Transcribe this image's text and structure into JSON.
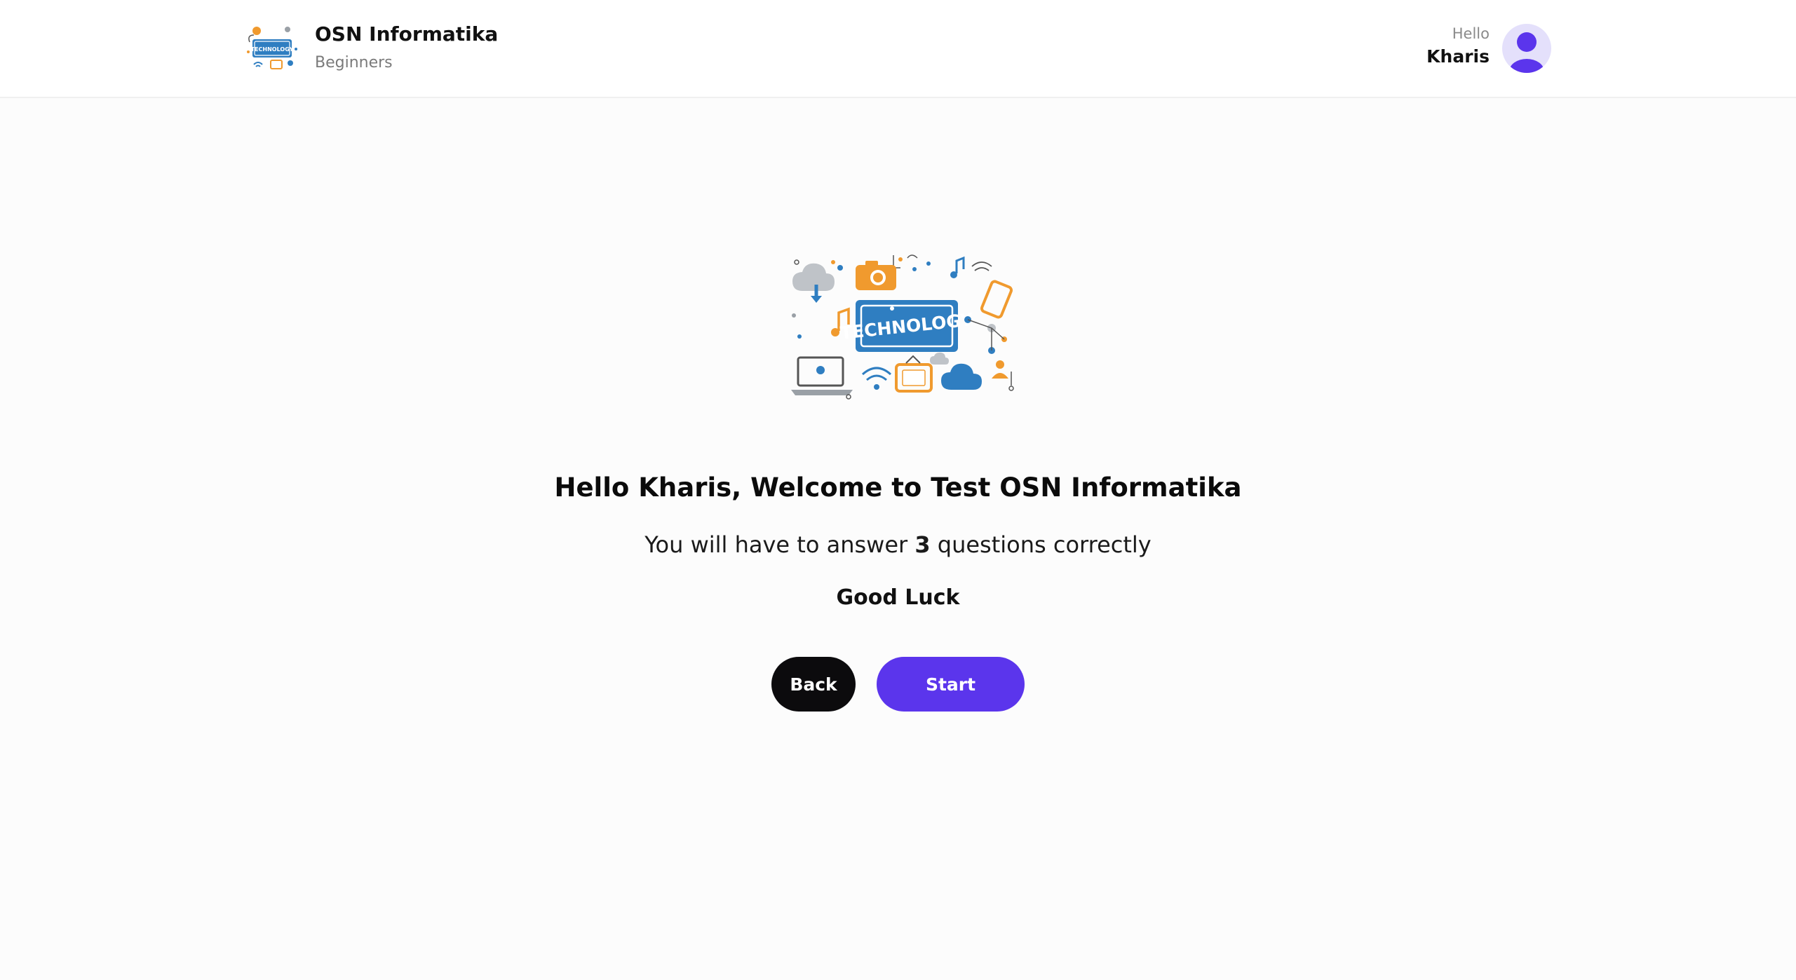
{
  "header": {
    "brand_title": "OSN Informatika",
    "brand_subtitle": "Beginners",
    "greeting": "Hello",
    "user_name": "Kharis",
    "logo_text": "TECHNOLOGY"
  },
  "main": {
    "hero_text": "TECHNOLOGY",
    "welcome": "Hello Kharis, Welcome to Test OSN Informatika",
    "instructions_prefix": "You will have to answer",
    "question_count": "3",
    "instructions_suffix": "questions correctly",
    "good_luck": "Good Luck",
    "back_label": "Back",
    "start_label": "Start"
  },
  "colors": {
    "accent": "#5b35ec",
    "dark_button": "#0c0b0d",
    "avatar_bg": "#e4e0fb",
    "tech_blue": "#2f7ec1",
    "tech_orange": "#f09a2e"
  }
}
